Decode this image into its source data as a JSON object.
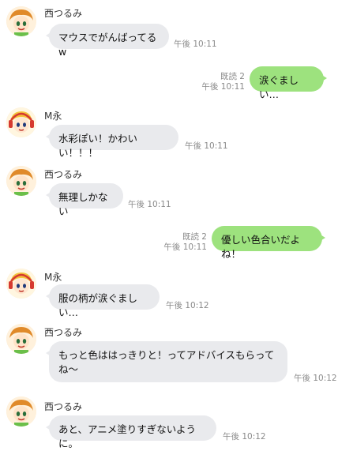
{
  "messages": [
    {
      "sender": "西つるみ",
      "text": "マウスでがんばってるw",
      "time": "午後 10:11"
    },
    {
      "read": "既読 2",
      "text": "涙ぐましい…",
      "time": "午後 10:11"
    },
    {
      "sender": "M永",
      "text": "水彩ぽい！かわいい！！！",
      "time": "午後 10:11"
    },
    {
      "sender": "西つるみ",
      "text": "無理しかない",
      "time": "午後 10:11"
    },
    {
      "read": "既読 2",
      "text": "優しい色合いだよね！",
      "time": "午後 10:11"
    },
    {
      "sender": "M永",
      "text": "服の柄が涙ぐましい…",
      "time": "午後 10:12"
    },
    {
      "sender": "西つるみ",
      "text": "もっと色ははっきりと！ってアドバイスもらってね〜",
      "time": "午後 10:12"
    },
    {
      "sender": "西つるみ",
      "text": "あと、アニメ塗りすぎないように。",
      "time": "午後 10:12"
    }
  ],
  "colors": {
    "incoming_bubble": "#e9eaed",
    "outgoing_bubble": "#9de27e"
  },
  "avatars": {
    "nishi": "anime-boy-avatar-icon",
    "mei": "anime-girl-headphones-avatar-icon"
  }
}
